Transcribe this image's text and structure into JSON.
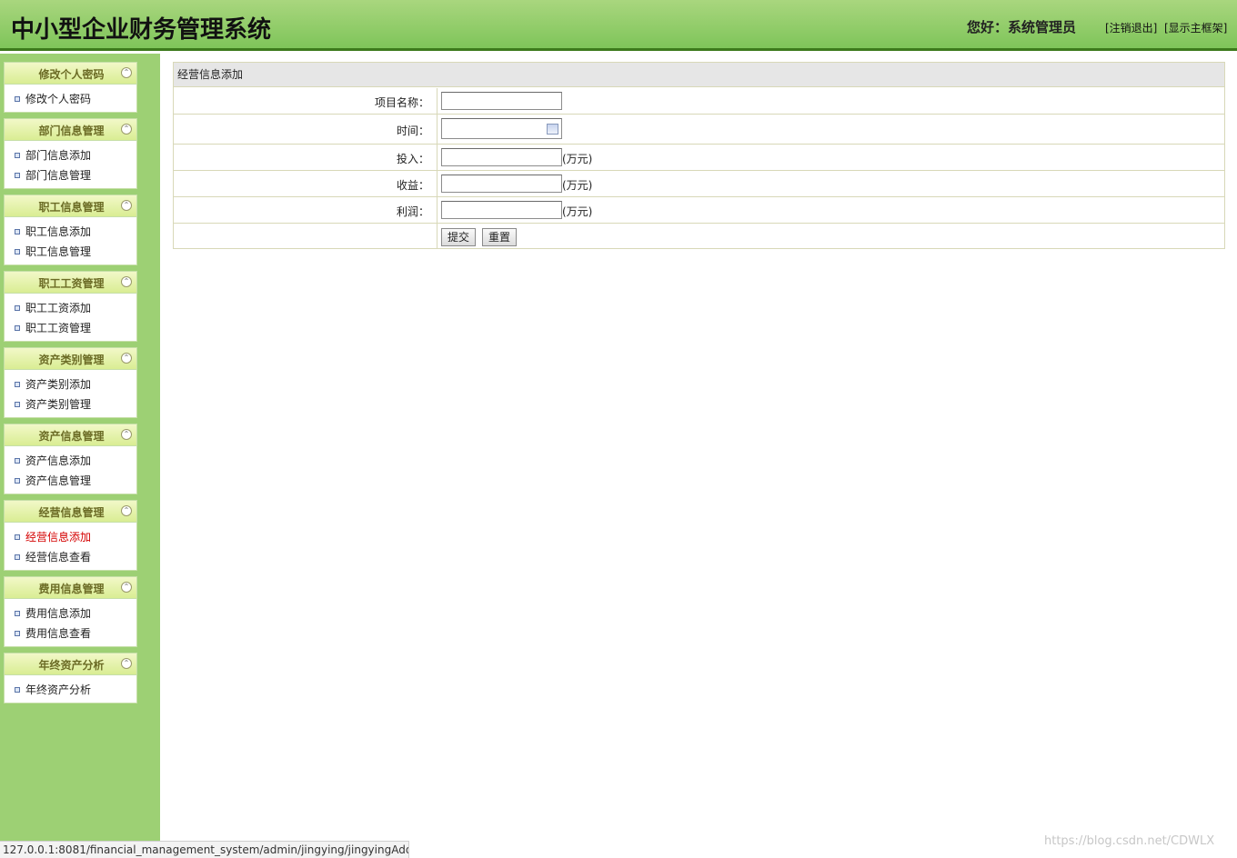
{
  "header": {
    "title": "中小型企业财务管理系统",
    "greeting": "您好：系统管理员",
    "logout": "[注销退出]",
    "show_frame": "[显示主框架]"
  },
  "sidebar": {
    "groups": [
      {
        "title": "修改个人密码",
        "items": [
          {
            "label": "修改个人密码"
          }
        ]
      },
      {
        "title": "部门信息管理",
        "items": [
          {
            "label": "部门信息添加"
          },
          {
            "label": "部门信息管理"
          }
        ]
      },
      {
        "title": "职工信息管理",
        "items": [
          {
            "label": "职工信息添加"
          },
          {
            "label": "职工信息管理"
          }
        ]
      },
      {
        "title": "职工工资管理",
        "items": [
          {
            "label": "职工工资添加"
          },
          {
            "label": "职工工资管理"
          }
        ]
      },
      {
        "title": "资产类别管理",
        "items": [
          {
            "label": "资产类别添加"
          },
          {
            "label": "资产类别管理"
          }
        ]
      },
      {
        "title": "资产信息管理",
        "items": [
          {
            "label": "资产信息添加"
          },
          {
            "label": "资产信息管理"
          }
        ]
      },
      {
        "title": "经营信息管理",
        "items": [
          {
            "label": "经营信息添加",
            "active": true
          },
          {
            "label": "经营信息查看"
          }
        ]
      },
      {
        "title": "费用信息管理",
        "items": [
          {
            "label": "费用信息添加"
          },
          {
            "label": "费用信息查看"
          }
        ]
      },
      {
        "title": "年终资产分析",
        "items": [
          {
            "label": "年终资产分析"
          }
        ]
      }
    ]
  },
  "form": {
    "title": "经营信息添加",
    "fields": {
      "project_name": {
        "label": "项目名称：",
        "value": ""
      },
      "time": {
        "label": "时间：",
        "value": ""
      },
      "investment": {
        "label": "投入：",
        "value": "",
        "unit": "(万元)"
      },
      "income": {
        "label": "收益：",
        "value": "",
        "unit": "(万元)"
      },
      "profit": {
        "label": "利润：",
        "value": "",
        "unit": "(万元)"
      }
    },
    "submit": "提交",
    "reset": "重置"
  },
  "status": {
    "url": "127.0.0.1:8081/financial_management_system/admin/jingying/jingyingAdd...."
  },
  "watermark": "https://blog.csdn.net/CDWLX"
}
